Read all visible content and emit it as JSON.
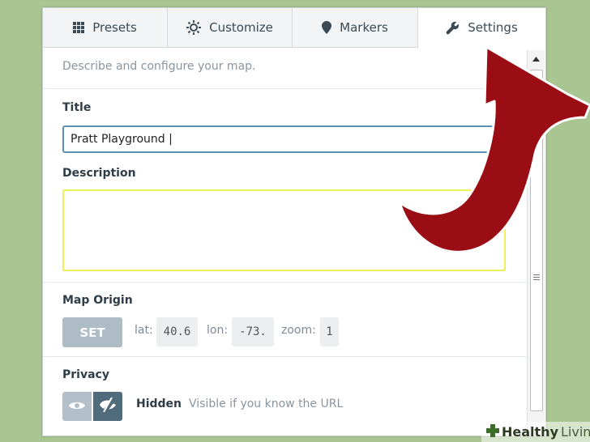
{
  "tabs": [
    {
      "label": "Presets",
      "icon": "grid-icon"
    },
    {
      "label": "Customize",
      "icon": "sun-icon"
    },
    {
      "label": "Markers",
      "icon": "map-pin-icon"
    },
    {
      "label": "Settings",
      "icon": "wrench-icon",
      "active": true
    }
  ],
  "settings": {
    "intro": "Describe and configure your map.",
    "title_label": "Title",
    "title_value": "Pratt Playground |",
    "description_label": "Description",
    "description_value": "",
    "origin_label": "Map Origin",
    "set_label": "SET",
    "lat_label": "lat:",
    "lat_value": "40.6",
    "lon_label": "lon:",
    "lon_value": "-73.",
    "zoom_label": "zoom:",
    "zoom_value": "1",
    "privacy_label": "Privacy",
    "privacy_state": "Hidden",
    "privacy_hint": "Visible if you know the URL"
  },
  "watermark": {
    "brand": "Healthy",
    "brand2": "Living"
  },
  "colors": {
    "background": "#a9c591",
    "arrow": "#9b0d14",
    "input_focus": "#5b8fb3",
    "description_border": "#eef05a",
    "privacy_active": "#506b7c"
  }
}
